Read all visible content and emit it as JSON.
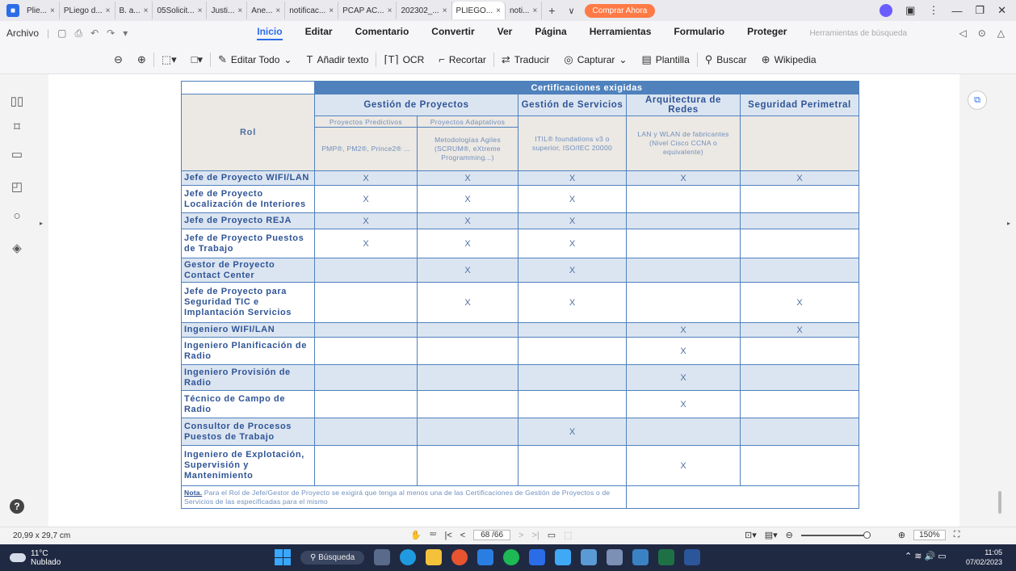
{
  "tabs": [
    {
      "label": "Plie..."
    },
    {
      "label": "PLiego d..."
    },
    {
      "label": "B. a..."
    },
    {
      "label": "05Solicit..."
    },
    {
      "label": "Justi..."
    },
    {
      "label": "Ane..."
    },
    {
      "label": "notificac..."
    },
    {
      "label": "PCAP AC..."
    },
    {
      "label": "202302_..."
    },
    {
      "label": "PLIEGO..."
    },
    {
      "label": "noti..."
    }
  ],
  "buy_label": "Comprar Ahora",
  "menu": {
    "archivo": "Archivo",
    "items": [
      "Inicio",
      "Editar",
      "Comentario",
      "Convertir",
      "Ver",
      "Página",
      "Herramientas",
      "Formulario",
      "Proteger"
    ],
    "search_tools": "Herramientas de búsqueda"
  },
  "toolbar": {
    "edit_all": "Editar Todo",
    "add_text": "Añadir texto",
    "ocr": "OCR",
    "crop": "Recortar",
    "translate": "Traducir",
    "capture": "Capturar",
    "template": "Plantilla",
    "search": "Buscar",
    "wikipedia": "Wikipedia"
  },
  "table": {
    "title": "Certificaciones exigidas",
    "rol_header": "Rol",
    "groups": [
      "Gestión de Proyectos",
      "Gestión de Servicios",
      "Arquitectura de Redes",
      "Seguridad Perimetral"
    ],
    "subgroups": [
      "Proyectos Predictivos",
      "Proyectos Adaptativos"
    ],
    "descriptions": [
      "PMP®, PM2®, Prince2® ...",
      "Metodologías Agiles (SCRUM®, eXtreme Programming...)",
      "ITIL® foundations v3 o superior, ISO/IEC 20000",
      "LAN y WLAN de fabricantes (Nivel Cisco CCNA o equivalente)",
      ""
    ],
    "rows": [
      {
        "role": "Jefe de Proyecto WIFI/LAN",
        "marks": [
          "X",
          "X",
          "X",
          "X",
          "X"
        ]
      },
      {
        "role": "Jefe de Proyecto Localización de Interiores",
        "marks": [
          "X",
          "X",
          "X",
          "",
          ""
        ]
      },
      {
        "role": "Jefe de Proyecto REJA",
        "marks": [
          "X",
          "X",
          "X",
          "",
          ""
        ]
      },
      {
        "role": "Jefe de Proyecto Puestos de Trabajo",
        "marks": [
          "X",
          "X",
          "X",
          "",
          ""
        ]
      },
      {
        "role": "Gestor de Proyecto Contact Center",
        "marks": [
          "",
          "X",
          "X",
          "",
          ""
        ]
      },
      {
        "role": "Jefe de Proyecto para Seguridad TIC e Implantación Servicios",
        "marks": [
          "",
          "X",
          "X",
          "",
          "X"
        ]
      },
      {
        "role": "Ingeniero WIFI/LAN",
        "marks": [
          "",
          "",
          "",
          "X",
          "X"
        ]
      },
      {
        "role": "Ingeniero Planificación de Radio",
        "marks": [
          "",
          "",
          "",
          "X",
          ""
        ]
      },
      {
        "role": "Ingeniero Provisión de Radio",
        "marks": [
          "",
          "",
          "",
          "X",
          ""
        ]
      },
      {
        "role": "Técnico de Campo de Radio",
        "marks": [
          "",
          "",
          "",
          "X",
          ""
        ]
      },
      {
        "role": "Consultor de Procesos Puestos de Trabajo",
        "marks": [
          "",
          "",
          "X",
          "",
          ""
        ]
      },
      {
        "role": "Ingeniero de Explotación, Supervisión y Mantenimiento",
        "marks": [
          "",
          "",
          "",
          "X",
          ""
        ]
      }
    ],
    "note_label": "Nota.",
    "note_text": " Para el Rol de Jefe/Gestor de Proyecto se exigirá que tenga al menos una de las Certificaciones de Gestión de Proyectos o de Servicios de las especificadas para el mismo"
  },
  "status": {
    "page_size": "20,99 x 29,7 cm",
    "page_indicator": "68 /66",
    "zoom": "150%"
  },
  "taskbar": {
    "temp": "11°C",
    "weather": "Nublado",
    "search": "Búsqueda",
    "time": "11:05",
    "date": "07/02/2023"
  },
  "colors": {
    "table_header": "#4f81bd",
    "row_alt": "#dbe5f1",
    "accent": "#2b6de8",
    "buy": "#ff7a45"
  }
}
